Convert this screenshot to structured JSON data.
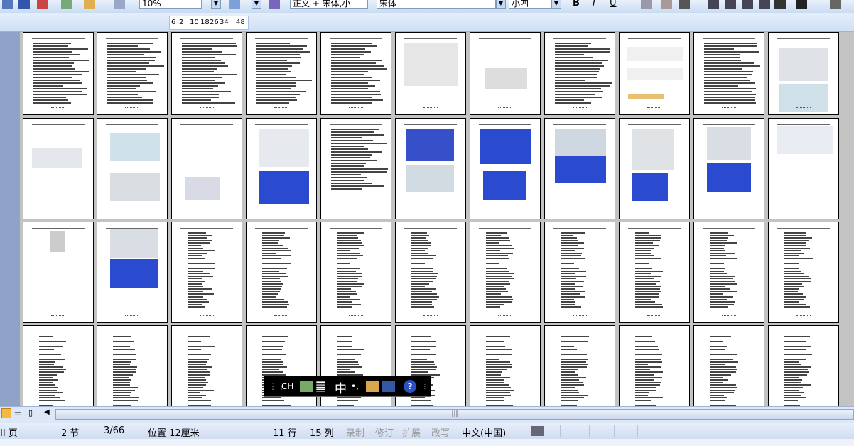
{
  "toolbar": {
    "zoom_value": "10%",
    "style_value": "正文 + 宋体,小",
    "font_value": "宋体",
    "size_value": "小四",
    "bold_label": "B",
    "italic_label": "I",
    "underline_label": "U"
  },
  "ruler": {
    "marks": [
      "6",
      "2",
      "10",
      "18",
      "26",
      "34",
      "48"
    ]
  },
  "langbar": {
    "ch": "CH",
    "zhong": "中",
    "punct": "•,",
    "help": "?"
  },
  "status": {
    "page_label": "II 页",
    "section_label": "2 节",
    "page_count": "3/66",
    "position": "位置 12厘米",
    "line": "11 行",
    "column": "15 列",
    "rec": "录制",
    "trk": "修订",
    "ext": "扩展",
    "ovr": "改写",
    "language": "中文(中国)"
  },
  "colors": {
    "toolbar_blue": "#c9dbf3",
    "doc_background": "#c3c3c3",
    "model_blue": "#2244cc",
    "model_gray": "#cfd8e0"
  }
}
